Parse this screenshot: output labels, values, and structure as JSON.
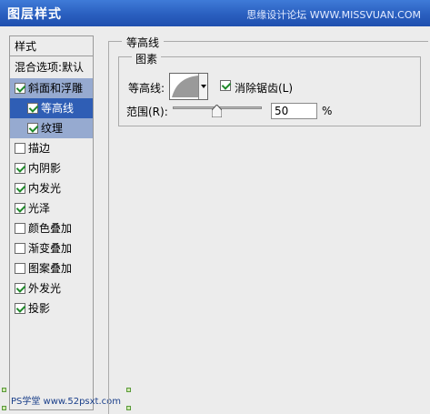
{
  "window": {
    "title": "图层样式",
    "watermark": "思缘设计论坛 WWW.MISSVUAN.COM"
  },
  "sidebar": {
    "header": "样式",
    "blend_options": "混合选项:默认",
    "items": [
      {
        "label": "斜面和浮雕",
        "checked": true
      },
      {
        "label": "等高线",
        "checked": true
      },
      {
        "label": "纹理",
        "checked": true
      },
      {
        "label": "描边",
        "checked": false
      },
      {
        "label": "内阴影",
        "checked": true
      },
      {
        "label": "内发光",
        "checked": true
      },
      {
        "label": "光泽",
        "checked": true
      },
      {
        "label": "颜色叠加",
        "checked": false
      },
      {
        "label": "渐变叠加",
        "checked": false
      },
      {
        "label": "图案叠加",
        "checked": false
      },
      {
        "label": "外发光",
        "checked": true
      },
      {
        "label": "投影",
        "checked": true
      }
    ],
    "footer_watermark": "PS学堂 www.52psxt.com"
  },
  "panel": {
    "group_title": "等高线",
    "subgroup_title": "图素",
    "contour_label": "等高线:",
    "antialias_label": "消除锯齿(L)",
    "antialias_checked": true,
    "range_label": "范围(R):",
    "range_value": "50",
    "range_unit": "%",
    "range_fraction": 0.5
  }
}
